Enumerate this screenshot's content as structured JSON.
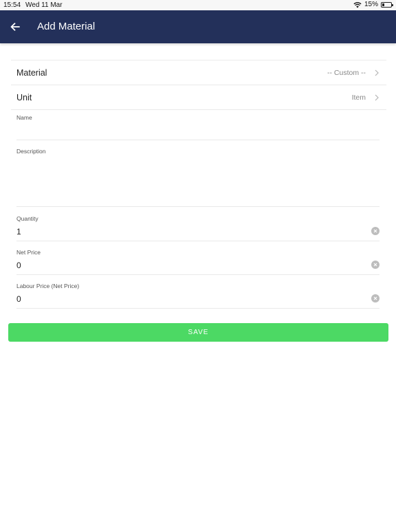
{
  "status_bar": {
    "time": "15:54",
    "date": "Wed 11 Mar",
    "battery": "15%"
  },
  "header": {
    "title": "Add Material",
    "back_icon": "arrow-left-icon",
    "background": "#23305a"
  },
  "form": {
    "material": {
      "label": "Material",
      "value": "-- Custom --"
    },
    "unit": {
      "label": "Unit",
      "value": "Item"
    },
    "name": {
      "label": "Name",
      "value": ""
    },
    "description": {
      "label": "Description",
      "value": ""
    },
    "quantity": {
      "label": "Quantity",
      "value": "1"
    },
    "net_price": {
      "label": "Net Price",
      "value": "0"
    },
    "labour_price": {
      "label": "Labour Price (Net Price)",
      "value": "0"
    }
  },
  "save": {
    "label": "SAVE",
    "color": "#4cd964"
  }
}
